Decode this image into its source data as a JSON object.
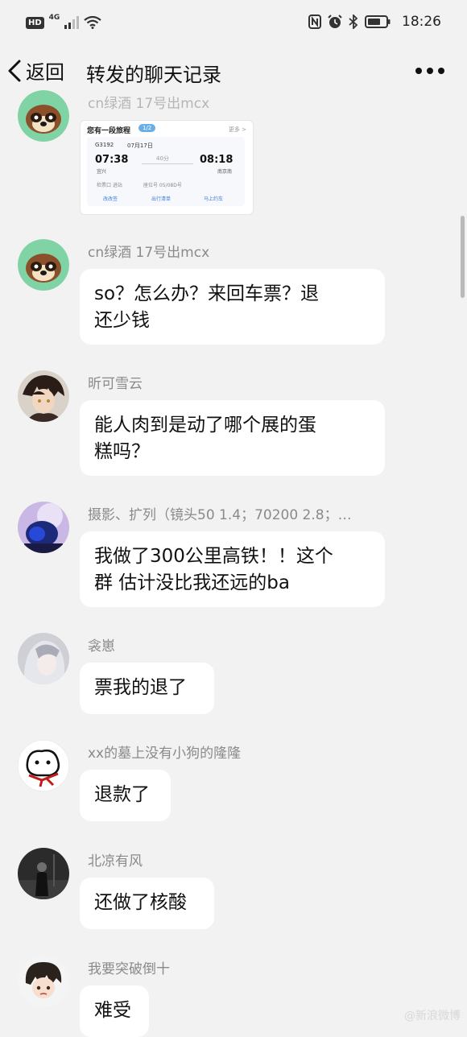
{
  "status_bar": {
    "hd": "HD",
    "network": "4G",
    "time": "18:26",
    "icons": [
      "signal-icon",
      "wifi-icon",
      "nfc-icon",
      "alarm-icon",
      "bluetooth-icon",
      "battery-icon"
    ]
  },
  "nav": {
    "back_label": "返回",
    "title": "转发的聊天记录",
    "more_icon": "more-icon"
  },
  "card": {
    "sender_partial": "cn绿酒 17号出mcx",
    "header": "您有一段旅程",
    "page": "1/2",
    "more": "更多 >",
    "train": "G3192",
    "date": "07月17日",
    "dep_time": "07:38",
    "arr_time": "08:18",
    "duration": "40分",
    "from": "宜兴",
    "to": "南京南",
    "gate": "检票口 进站",
    "seat": "座位号 05/08D号",
    "actions": [
      "改改签",
      "出行清单",
      "马上约车"
    ]
  },
  "messages": [
    {
      "sender": "cn绿酒 17号出mcx",
      "text_lines": [
        "so？怎么办？来回车票？退",
        "还少钱"
      ],
      "avatar": "raccoon"
    },
    {
      "sender": "昕可雪云",
      "text_lines": [
        "能人肉到是动了哪个展的蛋",
        "糕吗？"
      ],
      "avatar": "anime-boy"
    },
    {
      "sender": "摄影、扩列（镜头50 1.4；70200 2.8；…",
      "text_lines": [
        "我做了300公里高铁！！这个",
        "群 估计没比我还远的ba"
      ],
      "avatar": "blue-night"
    },
    {
      "sender": "衾崽",
      "text_lines": [
        "票我的退了"
      ],
      "avatar": "silver-hair"
    },
    {
      "sender": "xx的墓上没有小狗的隆隆",
      "text_lines": [
        "退款了"
      ],
      "avatar": "doodle-dog"
    },
    {
      "sender": "北凉有风",
      "text_lines": [
        "还做了核酸"
      ],
      "avatar": "dark-street"
    },
    {
      "sender": "我要突破倒十",
      "text_lines": [
        "难受"
      ],
      "avatar": "chibi-boy"
    }
  ],
  "watermark": "@新浪微博",
  "colors": {
    "background": "#f2f2f2",
    "bubble": "#ffffff",
    "sender": "#8a8a8a",
    "accent": "#3d7ee0"
  }
}
